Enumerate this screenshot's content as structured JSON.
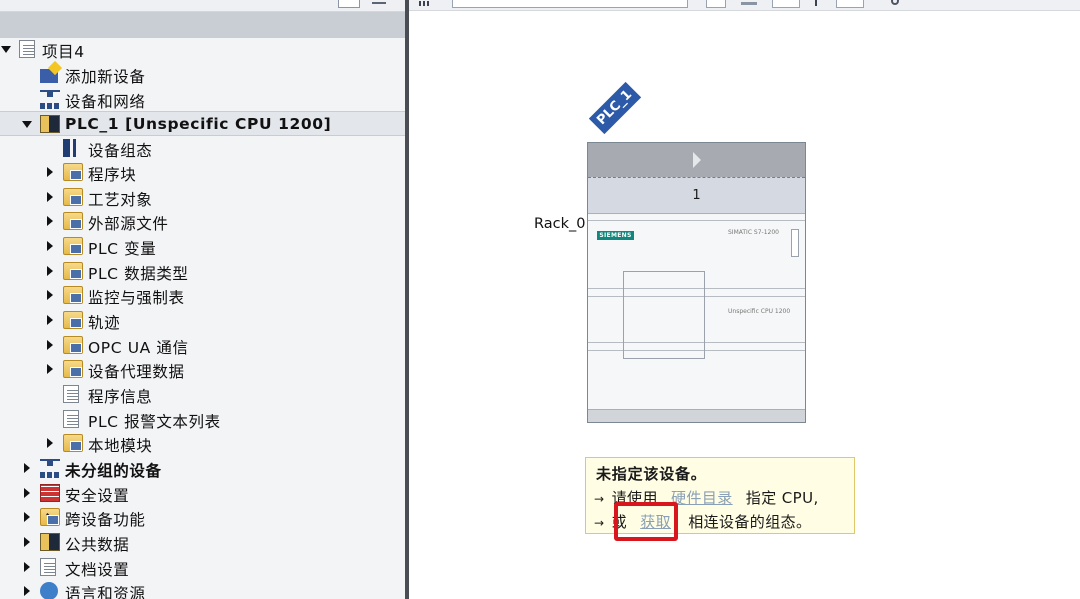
{
  "tree": {
    "rows": [
      {
        "label": "项目4",
        "name": "tree-item-project4",
        "icon": "project-icon"
      },
      {
        "label": "添加新设备",
        "name": "tree-item-add-new-device",
        "icon": "add-device-icon"
      },
      {
        "label": "设备和网络",
        "name": "tree-item-devices-networks",
        "icon": "network-icon"
      },
      {
        "label": "PLC_1 [Unspecific CPU 1200]",
        "name": "tree-item-plc1",
        "icon": "plc-icon"
      },
      {
        "label": "设备组态",
        "name": "tree-item-device-config",
        "icon": "device-config-icon"
      },
      {
        "label": "程序块",
        "name": "tree-item-program-blocks",
        "icon": "program-blocks-folder-icon"
      },
      {
        "label": "工艺对象",
        "name": "tree-item-technology-objects",
        "icon": "technology-objects-folder-icon"
      },
      {
        "label": "外部源文件",
        "name": "tree-item-external-sources",
        "icon": "external-sources-folder-icon"
      },
      {
        "label": "PLC 变量",
        "name": "tree-item-plc-tags",
        "icon": "plc-tags-folder-icon"
      },
      {
        "label": "PLC 数据类型",
        "name": "tree-item-plc-datatypes",
        "icon": "plc-datatypes-folder-icon"
      },
      {
        "label": "监控与强制表",
        "name": "tree-item-watch-force-tables",
        "icon": "watch-tables-folder-icon"
      },
      {
        "label": "轨迹",
        "name": "tree-item-traces",
        "icon": "traces-folder-icon"
      },
      {
        "label": "OPC UA 通信",
        "name": "tree-item-opc-ua",
        "icon": "opc-ua-folder-icon"
      },
      {
        "label": "设备代理数据",
        "name": "tree-item-device-proxy",
        "icon": "device-proxy-folder-icon"
      },
      {
        "label": "程序信息",
        "name": "tree-item-program-info",
        "icon": "program-info-icon"
      },
      {
        "label": "PLC 报警文本列表",
        "name": "tree-item-alarm-text-lists",
        "icon": "alarm-text-list-icon"
      },
      {
        "label": "本地模块",
        "name": "tree-item-local-modules",
        "icon": "local-modules-folder-icon"
      },
      {
        "label": "未分组的设备",
        "name": "tree-item-ungrouped-devices",
        "icon": "ungrouped-devices-icon"
      },
      {
        "label": "安全设置",
        "name": "tree-item-security-settings",
        "icon": "security-wall-icon"
      },
      {
        "label": "跨设备功能",
        "name": "tree-item-cross-device-functions",
        "icon": "cross-device-icon"
      },
      {
        "label": "公共数据",
        "name": "tree-item-common-data",
        "icon": "common-data-icon"
      },
      {
        "label": "文档设置",
        "name": "tree-item-documentation-settings",
        "icon": "documentation-icon"
      },
      {
        "label": "语言和资源",
        "name": "tree-item-languages-resources",
        "icon": "languages-resources-icon"
      }
    ]
  },
  "device_view": {
    "plc_tag": "PLC_1",
    "rack_label": "Rack_0",
    "slot_number": "1",
    "siemens_badge": "SIEMENS",
    "simatic_label": "SIMATIC S7-1200",
    "cpu_label": "Unspecific CPU 1200"
  },
  "info_box": {
    "title": "未指定该设备。",
    "line1_prefix": "请使用",
    "line1_link": "硬件目录",
    "line1_suffix": "指定 CPU,",
    "line2_prefix": "或",
    "line2_link": "获取",
    "line2_suffix": "相连设备的组态。",
    "arrow": "→"
  }
}
